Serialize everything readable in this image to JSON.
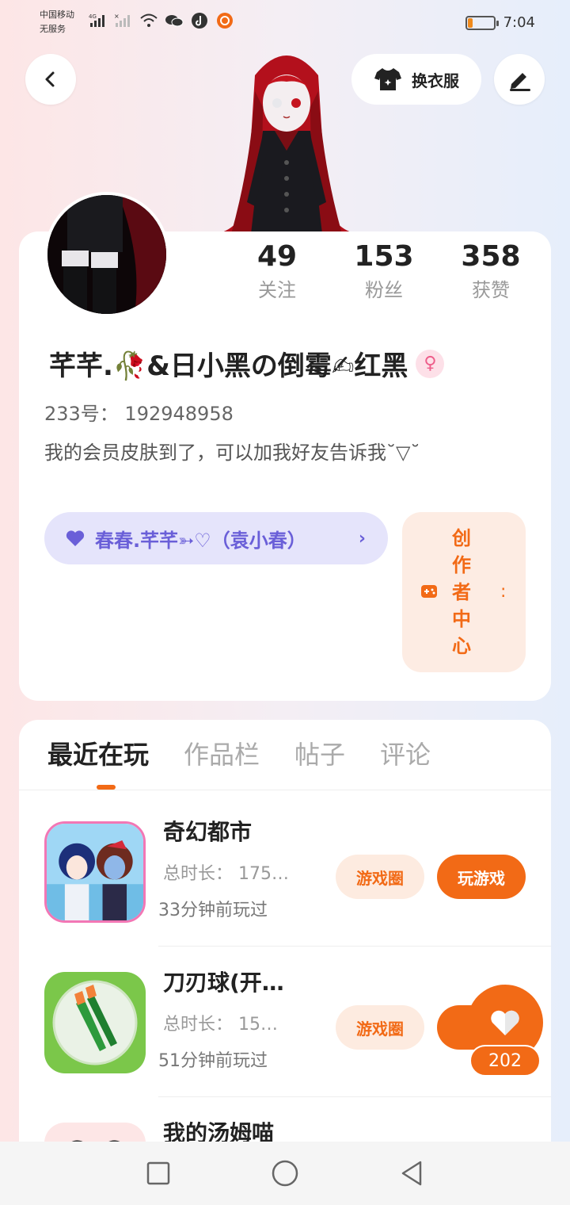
{
  "status_bar": {
    "carrier_line1": "中国移动",
    "carrier_line2": "无服务",
    "network": "4G",
    "time": "7:04",
    "battery_level": 0.18,
    "icons": [
      "signal-icon",
      "no-signal-icon",
      "wifi-icon",
      "wechat-icon",
      "tiktok-icon",
      "app-icon"
    ]
  },
  "header": {
    "outfit_label": "换衣服"
  },
  "profile": {
    "stats": [
      {
        "value": "49",
        "label": "关注"
      },
      {
        "value": "153",
        "label": "粉丝"
      },
      {
        "value": "358",
        "label": "获赞"
      }
    ],
    "nickname": "芊芊.🥀&日小黑の倒霉✍红黑",
    "gender_icon": "♀",
    "uid": "233号： 192948958",
    "bio": "我的会员皮肤到了，可以加我好友告诉我˘▽˘",
    "guild": "春春.芊芊➳♡（袁小春）",
    "creator_center": "创作者中心"
  },
  "tabs": [
    {
      "label": "最近在玩",
      "active": true
    },
    {
      "label": "作品栏",
      "active": false
    },
    {
      "label": "帖子",
      "active": false
    },
    {
      "label": "评论",
      "active": false
    }
  ],
  "games": [
    {
      "name": "奇幻都市",
      "duration": "总时长： 175…",
      "last_played": "33分钟前玩过",
      "circle_label": "游戏圈",
      "play_label": "玩游戏"
    },
    {
      "name": "刀刃球(开…",
      "duration": "总时长： 15…",
      "last_played": "51分钟前玩过",
      "circle_label": "游戏圈",
      "play_label": "玩"
    },
    {
      "name": "我的汤姆喵",
      "duration": "",
      "last_played": "",
      "circle_label": "",
      "play_label": ""
    }
  ],
  "like": {
    "count": "202"
  },
  "colors": {
    "accent": "#f26a16",
    "guild": "#6a5fd8"
  }
}
